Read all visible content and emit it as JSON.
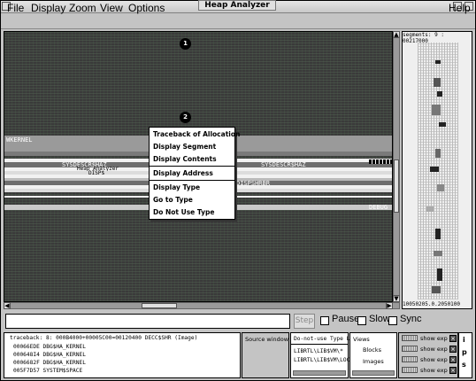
{
  "window": {
    "title": "Heap Analyzer"
  },
  "menubar": {
    "items": [
      "File",
      "Display",
      "Zoom",
      "View",
      "Options"
    ],
    "help": "Help"
  },
  "canvas": {
    "markers": [
      "1",
      "2"
    ],
    "band_label_main": "WKERNEL",
    "band_label_a": "SYSDESCR$HAZ",
    "band_label_b": "Heap Analyzer",
    "band_label_c": "DISP$",
    "band_label_d": "SYSDESCR$HAZ",
    "band_label_e": "DISPSHRBR",
    "band_label_f": "DEBUG"
  },
  "context_menu": {
    "items": [
      "Traceback of Allocation",
      "Display Segment",
      "Display Contents",
      "Display Address",
      "Display Type",
      "Go to Type",
      "Do Not Use Type"
    ]
  },
  "overview": {
    "header": "segments: 9 : 00217000",
    "footer": "10050205.0.2050100"
  },
  "controls": {
    "message": "",
    "step_label": "Step",
    "pause_label": "Pause",
    "slow_label": "Slow",
    "sync_label": "Sync"
  },
  "traceback": {
    "header": "traceback:    8: 000B4000+00005C00=00120400 DECC$SHR (Image)",
    "lines": [
      "00066EDE  DBG$HA_KERNEL",
      "000648I4  DBG$HA_KERNEL",
      "0006682F  DBG$HA_KERNEL",
      "005F7D57  SYSTEM$SPACE"
    ]
  },
  "source_window": {
    "label": "Source window"
  },
  "do_not_use": {
    "header": "Do-not-use Type L",
    "items": [
      "LIBRTL\\LIB$VM\\*",
      "LIBRTL\\LIB$VM\\LOC"
    ]
  },
  "views": {
    "header": "Views",
    "items": [
      "Blocks",
      "Images"
    ]
  },
  "show_rows": {
    "labels": [
      "show  exp",
      "show  exp",
      "show  exp",
      "show  exp"
    ]
  },
  "ips": {
    "letters": [
      "i",
      "p",
      "s"
    ]
  },
  "colors": {
    "canvas_bg": "#3a3a3a",
    "band_light": "#9a9a9a",
    "band_white": "#f2f2f2",
    "band_mid": "#6e6e6e"
  }
}
